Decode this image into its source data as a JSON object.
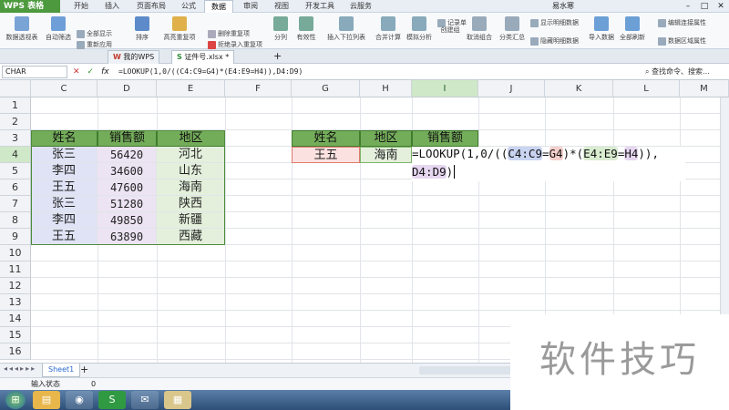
{
  "app": {
    "title": "WPS 表格"
  },
  "menu_tabs": [
    "开始",
    "插入",
    "页面布局",
    "公式",
    "数据",
    "审阅",
    "视图",
    "开发工具",
    "云服务"
  ],
  "active_menu_tab": "数据",
  "user": {
    "name": "易水寒"
  },
  "ribbon": {
    "items": [
      "数据透视表",
      "自动筛选",
      "全部显示",
      "重新应用",
      "排序",
      "高亮重复项",
      "删除重复项",
      "拒绝录入重复项",
      "分列",
      "有效性",
      "插入下拉列表",
      "合并计算",
      "模拟分析",
      "记录单",
      "创建组",
      "取消组合",
      "分类汇总",
      "显示明细数据",
      "隐藏明细数据",
      "导入数据",
      "全部刷新",
      "编辑连接属性",
      "数据区域属性"
    ]
  },
  "doc_tabs": [
    {
      "label": "我的WPS"
    },
    {
      "label": "证件号.xlsx *"
    }
  ],
  "formula_bar": {
    "name_box": "CHAR",
    "cancel_icon": "✕",
    "confirm_icon": "✓",
    "fx_label": "fx",
    "formula": "=LOOKUP(1,0/((C4:C9=G4)*(E4:E9=H4)),D4:D9)",
    "search": "查找命令、搜索..."
  },
  "columns": [
    "C",
    "D",
    "E",
    "F",
    "G",
    "H",
    "I",
    "J",
    "K",
    "L",
    "M"
  ],
  "rows": [
    "1",
    "2",
    "3",
    "4",
    "5",
    "6",
    "7",
    "8",
    "9",
    "10",
    "11",
    "12",
    "13",
    "14",
    "15",
    "16"
  ],
  "table_left": {
    "headers": [
      "姓名",
      "销售额",
      "地区"
    ],
    "rows": [
      [
        "张三",
        "56420",
        "河北"
      ],
      [
        "李四",
        "34600",
        "山东"
      ],
      [
        "王五",
        "47600",
        "海南"
      ],
      [
        "张三",
        "51280",
        "陕西"
      ],
      [
        "李四",
        "49850",
        "新疆"
      ],
      [
        "王五",
        "63890",
        "西藏"
      ]
    ]
  },
  "table_right": {
    "headers": [
      "姓名",
      "地区",
      "销售额"
    ],
    "row": [
      "王五",
      "海南"
    ]
  },
  "cell_formula": {
    "p1": "=LOOKUP(1,0/((",
    "r1": "C4:C9",
    "eq1": "=",
    "r2": "G4",
    "p2": ")*(",
    "r3": "E4:E9",
    "eq2": "=",
    "r4": "H4",
    "p3": ")),",
    "r5": "D4:D9",
    "p4": ")"
  },
  "sheet": {
    "tab": "Sheet1",
    "add": "+"
  },
  "status": {
    "mode": "输入状态",
    "count": "0"
  },
  "watermark": "软件技巧",
  "colors": {
    "header_green": "#74ad5a",
    "accent": "#4d9a3e"
  }
}
